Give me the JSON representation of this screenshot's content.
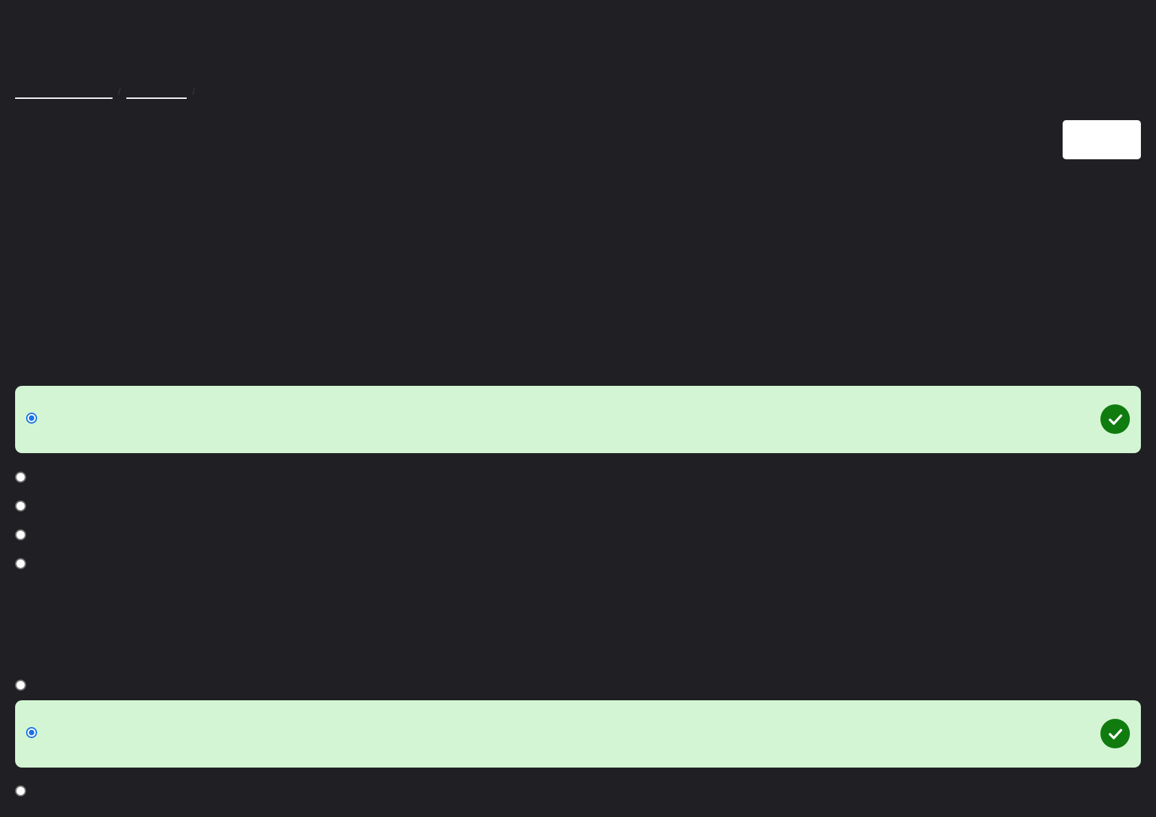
{
  "breadcrumb": {
    "items": [
      {
        "label": ""
      },
      {
        "label": ""
      }
    ],
    "separator": "/"
  },
  "header": {
    "action_button_label": ""
  },
  "questions": [
    {
      "options": [
        {
          "label": "",
          "selected": true,
          "correct": true
        },
        {
          "label": "",
          "selected": false
        },
        {
          "label": "",
          "selected": false
        },
        {
          "label": "",
          "selected": false
        },
        {
          "label": "",
          "selected": false
        }
      ]
    },
    {
      "options": [
        {
          "label": "",
          "selected": false
        },
        {
          "label": "",
          "selected": true,
          "correct": true
        },
        {
          "label": "",
          "selected": false
        }
      ]
    }
  ],
  "colors": {
    "background": "#202024",
    "correct_highlight": "#d3f5d3",
    "correct_icon": "#107c10",
    "radio_selected": "#1a73e8"
  },
  "icons": {
    "correct": "check-circle-icon"
  }
}
